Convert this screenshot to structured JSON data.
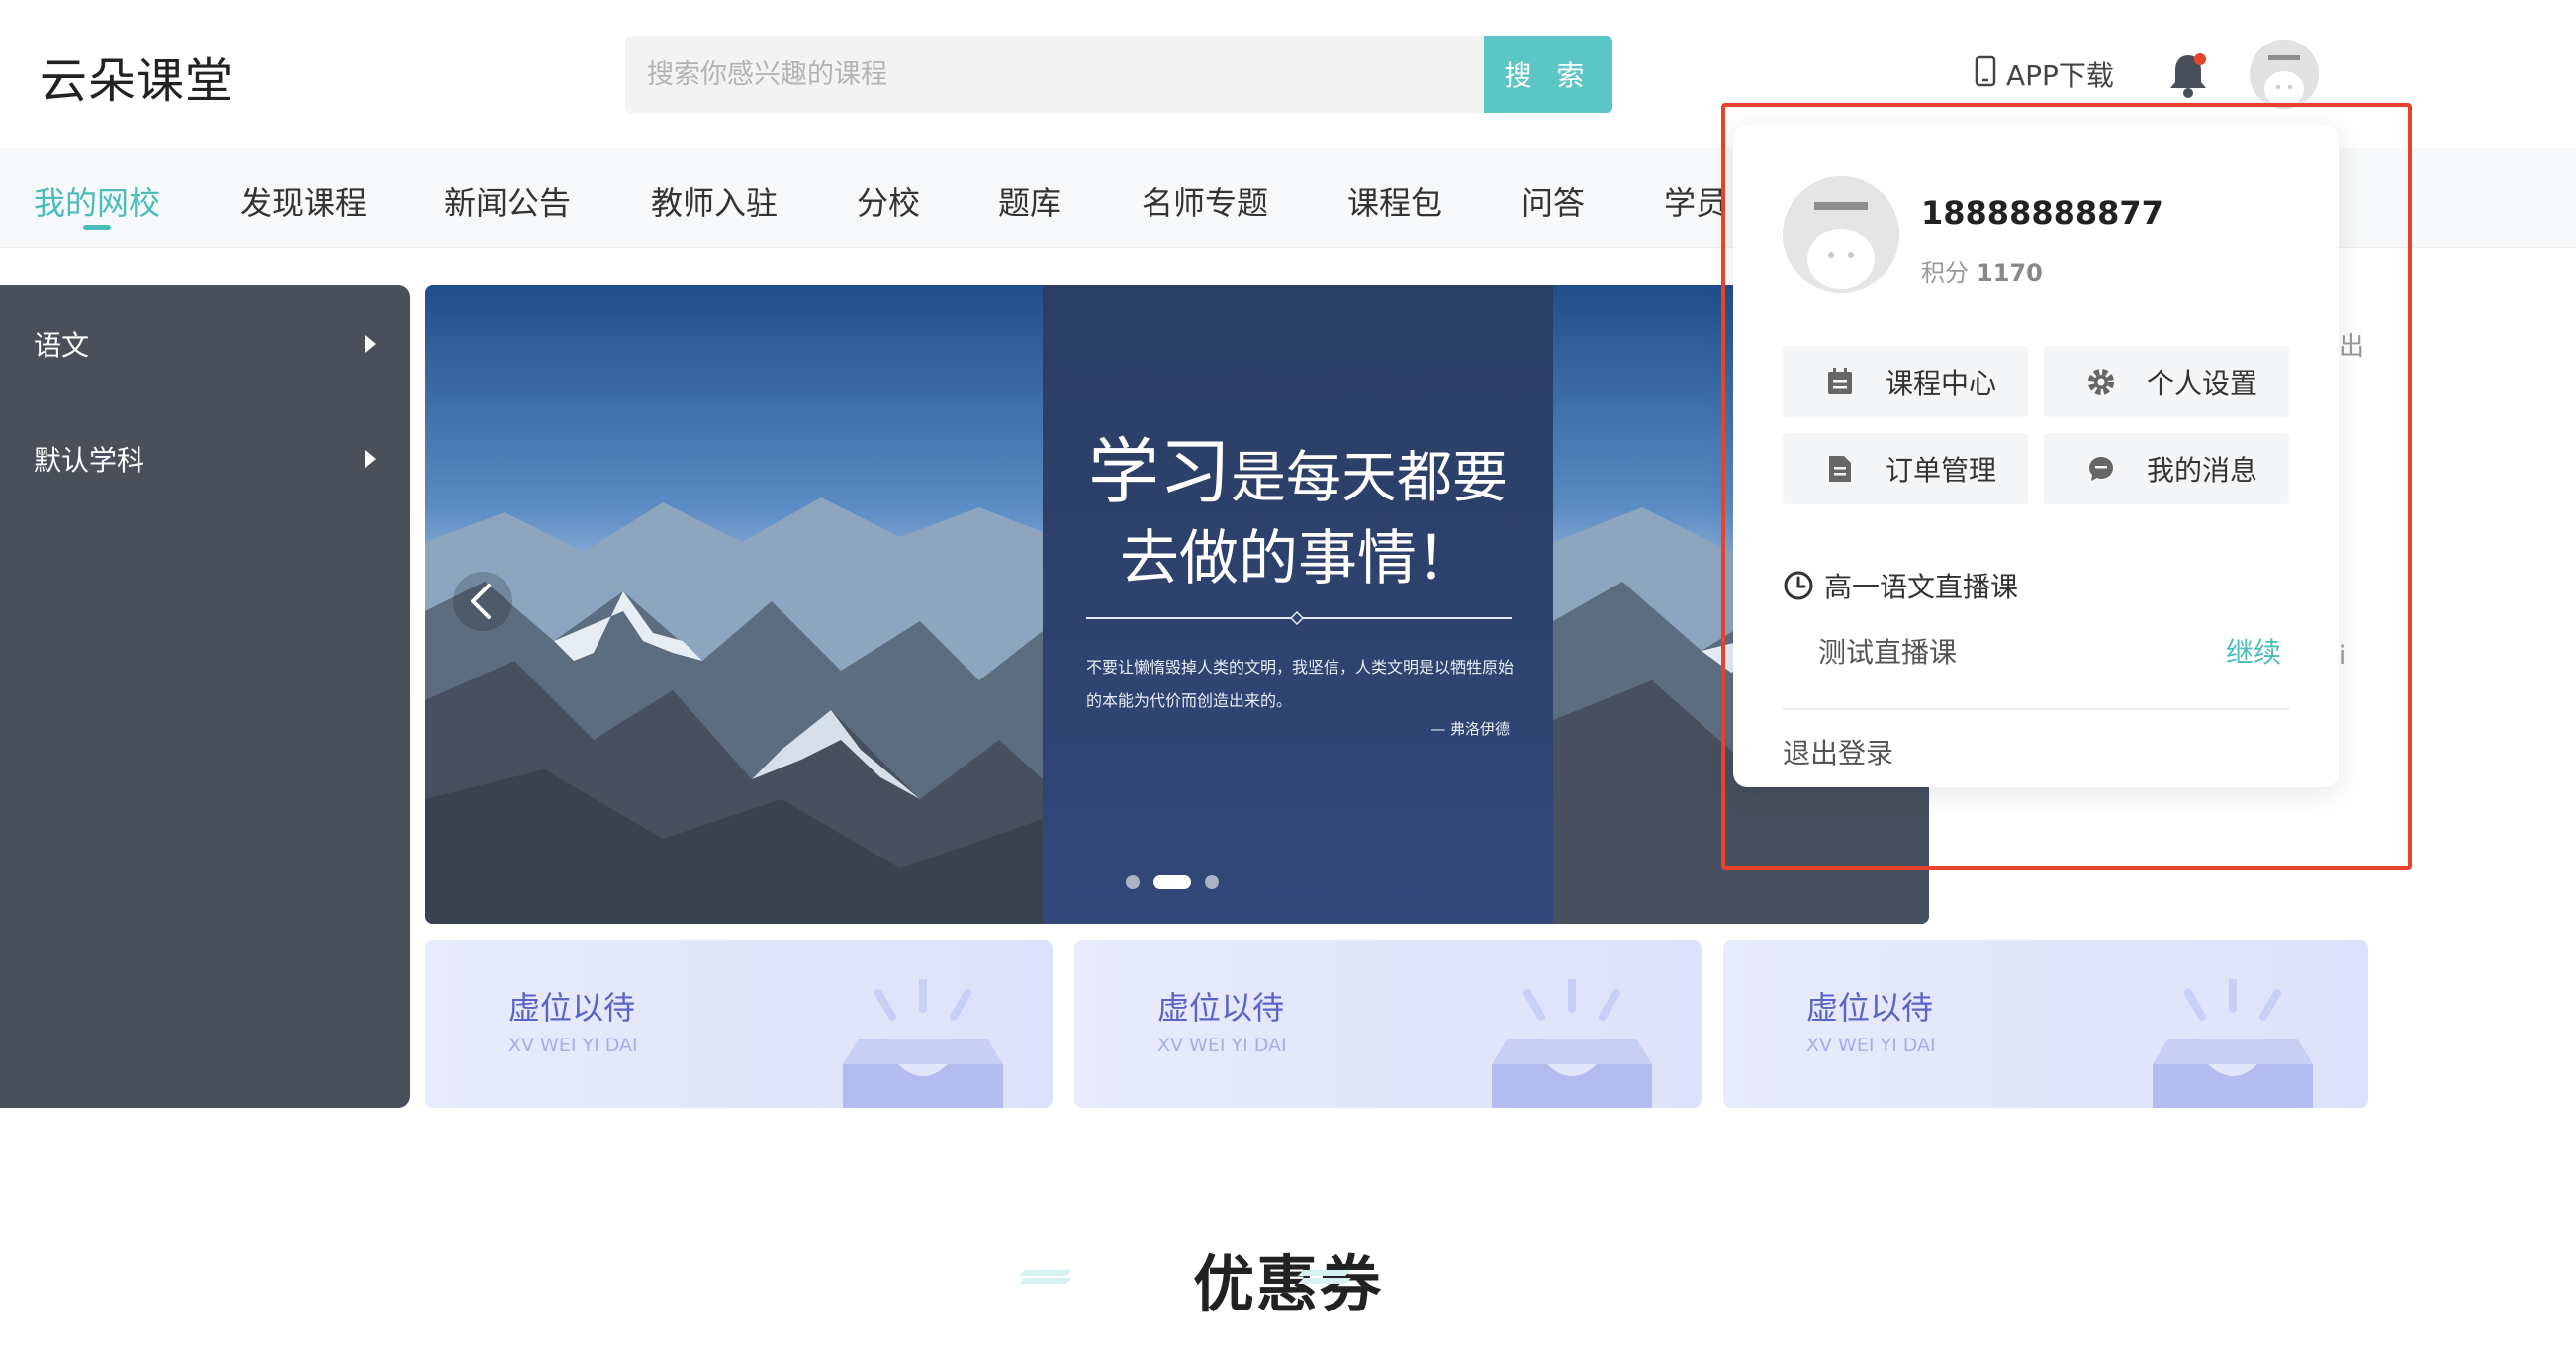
{
  "header": {
    "logo": "云朵课堂",
    "search_placeholder": "搜索你感兴趣的课程",
    "search_button": "搜 索",
    "app_download": "APP下载"
  },
  "nav": {
    "items": [
      "我的网校",
      "发现课程",
      "新闻公告",
      "教师入驻",
      "分校",
      "题库",
      "名师专题",
      "课程包",
      "问答",
      "学员"
    ]
  },
  "categories": {
    "items": [
      "语文",
      "默认学科"
    ]
  },
  "banner": {
    "title_big": "学习",
    "title_rest": "是每天都要",
    "title_line2": "去做的事情！",
    "quote": "不要让懒惰毁掉人类的文明，我坚信，人类文明是以牺牲原始的本能为代价而创造出来的。",
    "author": "— 弗洛伊德",
    "dots": 3,
    "active_dot": 2
  },
  "placeholders": [
    {
      "title": "虚位以待",
      "subtitle": "XV WEI YI DAI"
    },
    {
      "title": "虚位以待",
      "subtitle": "XV WEI YI DAI"
    },
    {
      "title": "虚位以待",
      "subtitle": "XV WEI YI DAI"
    }
  ],
  "coupon": {
    "title": "优惠券"
  },
  "dropdown": {
    "phone": "18888888877",
    "points_label": "积分",
    "points_value": "1170",
    "buttons": [
      "课程中心",
      "个人设置",
      "订单管理",
      "我的消息"
    ],
    "live_title": "高一语文直播课",
    "live_item": "测试直播课",
    "live_continue": "继续",
    "logout": "退出登录"
  },
  "peek": {
    "a": "出",
    "b": "i"
  },
  "colors": {
    "accent": "#4bbcbc",
    "dark_panel": "#4a4f5b",
    "highlight": "#e8412c"
  }
}
